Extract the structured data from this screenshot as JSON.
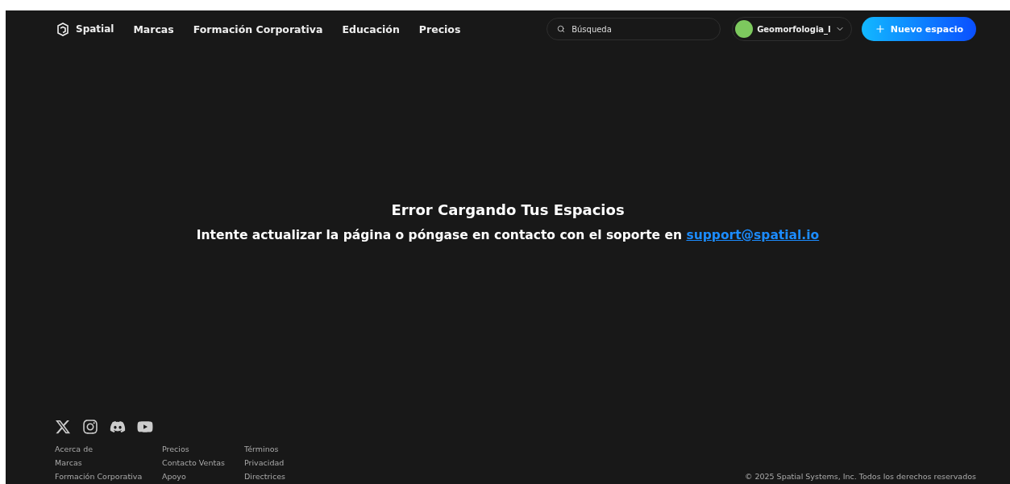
{
  "nav": {
    "logo": "Spatial",
    "links": [
      "Marcas",
      "Formación Corporativa",
      "Educación",
      "Precios"
    ]
  },
  "search": {
    "placeholder": "Búsqueda"
  },
  "account": {
    "name": "Geomorfologia_I"
  },
  "new_button": {
    "label": "Nuevo espacio"
  },
  "error": {
    "title": "Error Cargando Tus Espacios",
    "message": "Intente actualizar la página o póngase en contacto con el soporte en",
    "link": "support@spatial.io"
  },
  "footer": {
    "columns": [
      [
        "Acerca de",
        "Marcas",
        "Formación Corporativa"
      ],
      [
        "Precios",
        "Contacto Ventas",
        "Apoyo"
      ],
      [
        "Términos",
        "Privacidad",
        "Directrices"
      ]
    ],
    "copyright": "© 2025 Spatial Systems, Inc. Todos los derechos reservados"
  }
}
